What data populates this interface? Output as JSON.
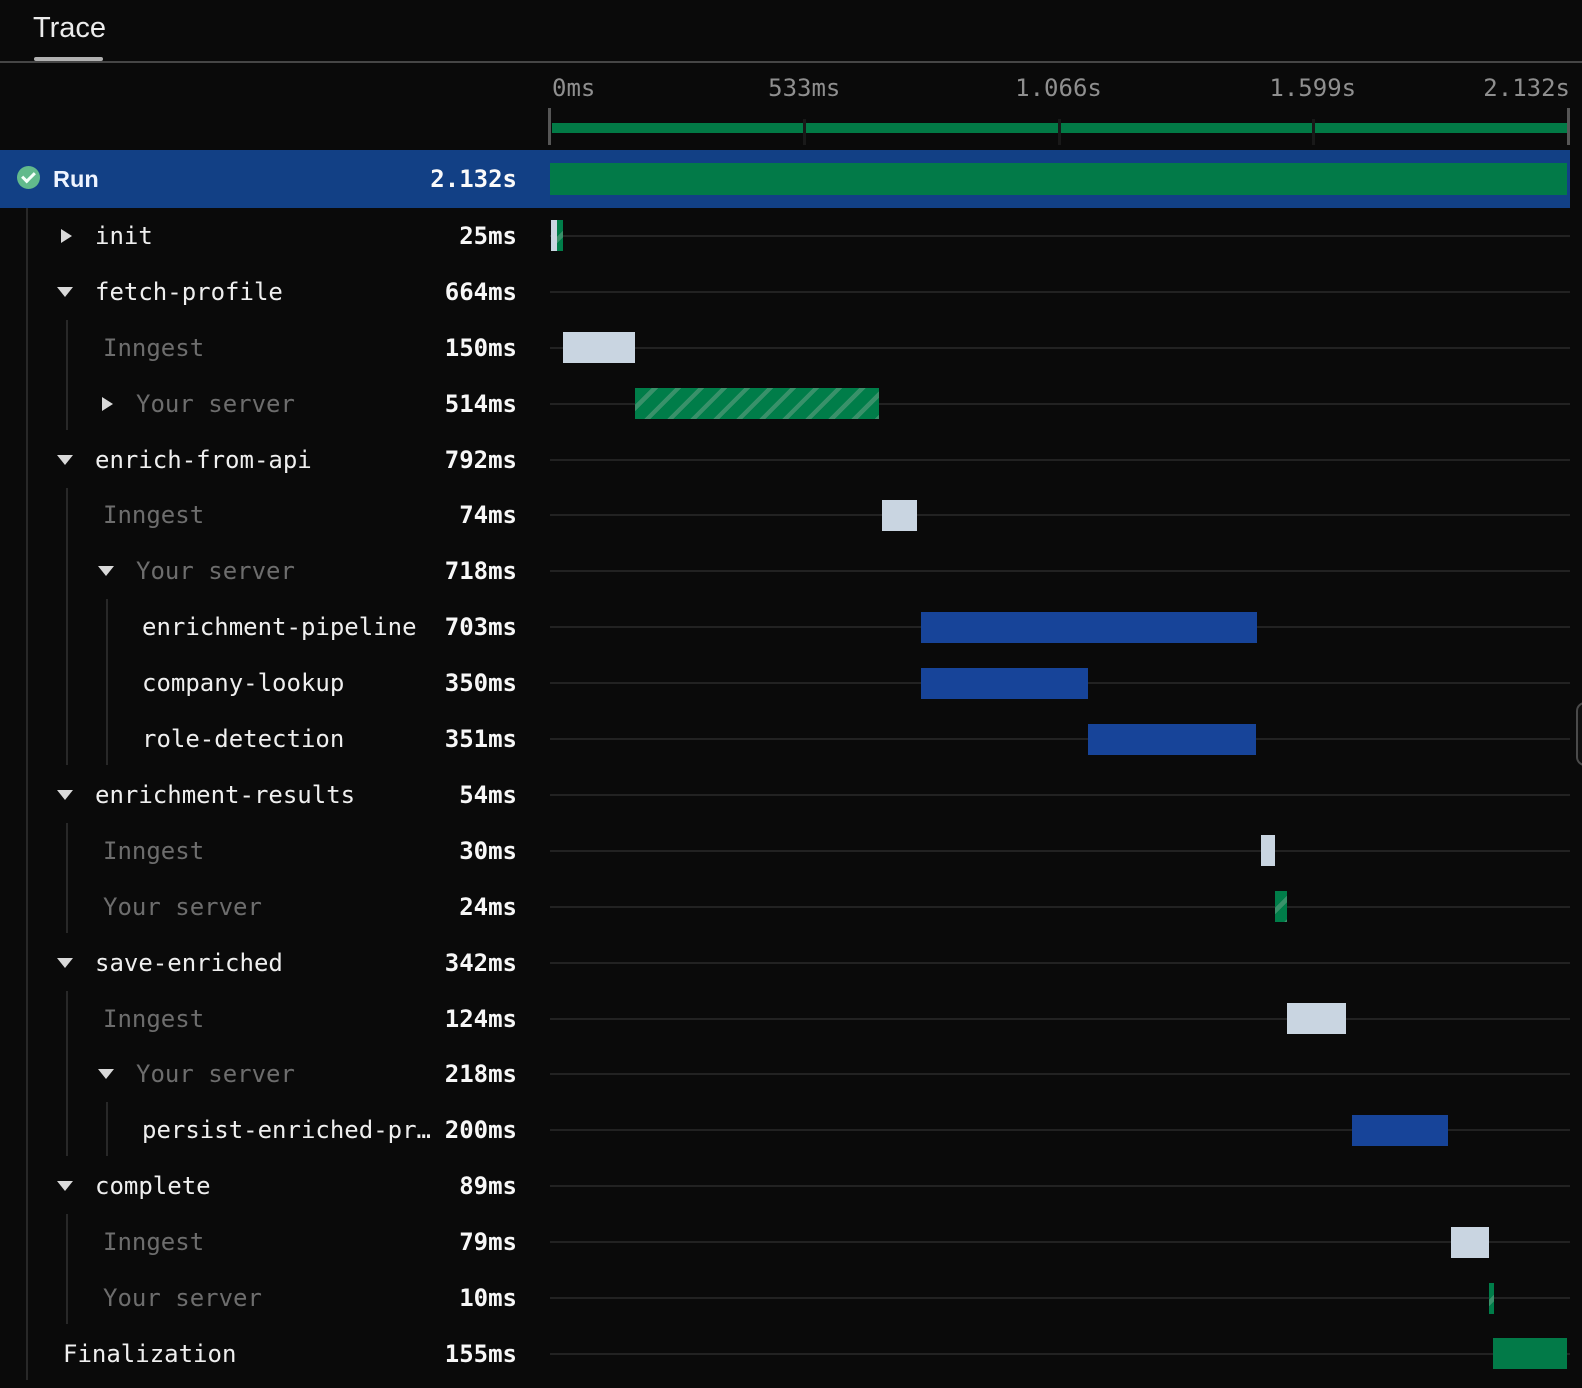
{
  "tab": {
    "title": "Trace"
  },
  "run": {
    "label": "Run",
    "duration": "2.132s",
    "status": "completed"
  },
  "colors": {
    "selected_row": "#124085",
    "run_green": "#027a48",
    "queue_gray": "#c9d5e1",
    "server_green": "#007d49",
    "server_green_stripe": "#39916a",
    "step_blue": "#174499"
  },
  "chart_data": {
    "type": "gantt-trace",
    "total_ms": 2132,
    "ticks": [
      {
        "label": "0ms",
        "t": 0
      },
      {
        "label": "533ms",
        "t": 533
      },
      {
        "label": "1.066s",
        "t": 1066
      },
      {
        "label": "1.599s",
        "t": 1599
      },
      {
        "label": "2.132s",
        "t": 2132
      }
    ],
    "run_bar": {
      "type": "green",
      "start": 0,
      "dur": 2132
    }
  },
  "spans": [
    {
      "label": "init",
      "duration": "25ms",
      "level": 1,
      "arrow": "collapsed",
      "bars": [
        {
          "type": "queue",
          "start": 2,
          "dur": 12
        },
        {
          "type": "hatch",
          "start": 14,
          "dur": 13
        }
      ]
    },
    {
      "label": "fetch-profile",
      "duration": "664ms",
      "level": 1,
      "arrow": "expanded",
      "bars": []
    },
    {
      "label": "Inngest",
      "duration": "150ms",
      "level": 2,
      "muted": true,
      "bars": [
        {
          "type": "queue",
          "start": 27,
          "dur": 151
        }
      ]
    },
    {
      "label": "Your server",
      "duration": "514ms",
      "level": 2,
      "muted": true,
      "arrow": "collapsed",
      "bars": [
        {
          "type": "hatch",
          "start": 178,
          "dur": 512
        }
      ]
    },
    {
      "label": "enrich-from-api",
      "duration": "792ms",
      "level": 1,
      "arrow": "expanded",
      "bars": []
    },
    {
      "label": "Inngest",
      "duration": "74ms",
      "level": 2,
      "muted": true,
      "bars": [
        {
          "type": "queue",
          "start": 696,
          "dur": 74
        }
      ]
    },
    {
      "label": "Your server",
      "duration": "718ms",
      "level": 2,
      "muted": true,
      "arrow": "expanded",
      "bars": []
    },
    {
      "label": "enrichment-pipeline",
      "duration": "703ms",
      "level": 3,
      "bars": [
        {
          "type": "blue",
          "start": 778,
          "dur": 704
        }
      ]
    },
    {
      "label": "company-lookup",
      "duration": "350ms",
      "level": 3,
      "bars": [
        {
          "type": "blue",
          "start": 778,
          "dur": 350
        }
      ]
    },
    {
      "label": "role-detection",
      "duration": "351ms",
      "level": 3,
      "bars": [
        {
          "type": "blue",
          "start": 1128,
          "dur": 352
        }
      ]
    },
    {
      "label": "enrichment-results",
      "duration": "54ms",
      "level": 1,
      "arrow": "expanded",
      "bars": []
    },
    {
      "label": "Inngest",
      "duration": "30ms",
      "level": 2,
      "muted": true,
      "bars": [
        {
          "type": "queue",
          "start": 1490,
          "dur": 30
        }
      ]
    },
    {
      "label": "Your server",
      "duration": "24ms",
      "level": 2,
      "muted": true,
      "bars": [
        {
          "type": "hatch",
          "start": 1520,
          "dur": 25
        }
      ]
    },
    {
      "label": "save-enriched",
      "duration": "342ms",
      "level": 1,
      "arrow": "expanded",
      "bars": []
    },
    {
      "label": "Inngest",
      "duration": "124ms",
      "level": 2,
      "muted": true,
      "bars": [
        {
          "type": "queue",
          "start": 1545,
          "dur": 124
        }
      ]
    },
    {
      "label": "Your server",
      "duration": "218ms",
      "level": 2,
      "muted": true,
      "arrow": "expanded",
      "bars": []
    },
    {
      "label": "persist-enriched-pr…",
      "duration": "200ms",
      "level": 3,
      "bars": [
        {
          "type": "blue",
          "start": 1682,
          "dur": 200
        }
      ]
    },
    {
      "label": "complete",
      "duration": "89ms",
      "level": 1,
      "arrow": "expanded",
      "bars": []
    },
    {
      "label": "Inngest",
      "duration": "79ms",
      "level": 2,
      "muted": true,
      "bars": [
        {
          "type": "queue",
          "start": 1889,
          "dur": 80
        }
      ]
    },
    {
      "label": "Your server",
      "duration": "10ms",
      "level": 2,
      "muted": true,
      "bars": [
        {
          "type": "hatch",
          "start": 1969,
          "dur": 10
        }
      ]
    },
    {
      "label": "Finalization",
      "duration": "155ms",
      "level": 0,
      "bars": [
        {
          "type": "green",
          "start": 1977,
          "dur": 155
        }
      ]
    }
  ]
}
